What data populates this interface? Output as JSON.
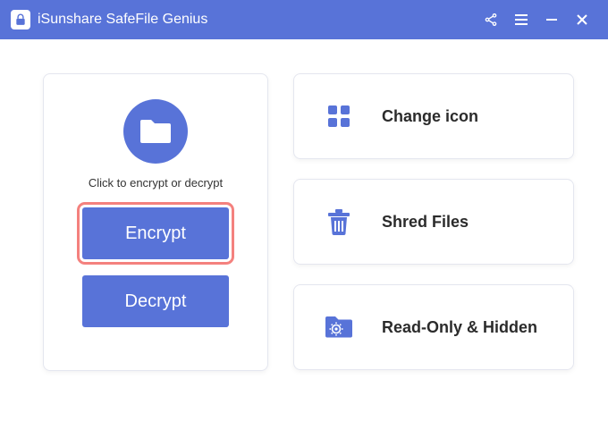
{
  "app": {
    "title": "iSunshare SafeFile Genius"
  },
  "main": {
    "hint": "Click to encrypt or decrypt",
    "encrypt_label": "Encrypt",
    "decrypt_label": "Decrypt"
  },
  "options": {
    "change_icon": "Change icon",
    "shred_files": "Shred Files",
    "read_only_hidden": "Read-Only & Hidden"
  },
  "colors": {
    "primary": "#5873d8",
    "highlight": "#f4817e"
  }
}
